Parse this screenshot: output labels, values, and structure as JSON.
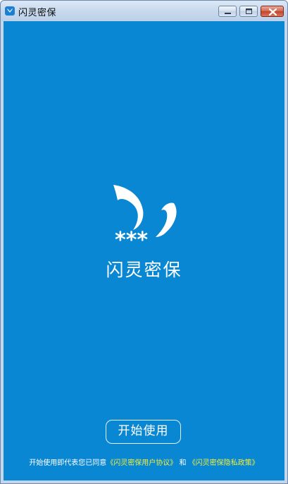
{
  "window": {
    "title": "闪灵密保",
    "icon": "app-logo-icon",
    "controls": {
      "minimize": "minimize-icon",
      "maximize": "maximize-icon",
      "close": "close-icon"
    }
  },
  "main": {
    "logo_icon": "butterfly-logo-icon",
    "logo_stars": "***",
    "app_name": "闪灵密保",
    "start_button": "开始使用",
    "agreement": {
      "prefix": "开始使用即代表您已同意",
      "user_agreement": "《闪灵密保用户协议》",
      "connector": "和",
      "privacy_policy": "《闪灵密保隐私政策》"
    }
  },
  "colors": {
    "background": "#0987d3",
    "link": "#f1ee3b",
    "text": "#ffffff"
  }
}
